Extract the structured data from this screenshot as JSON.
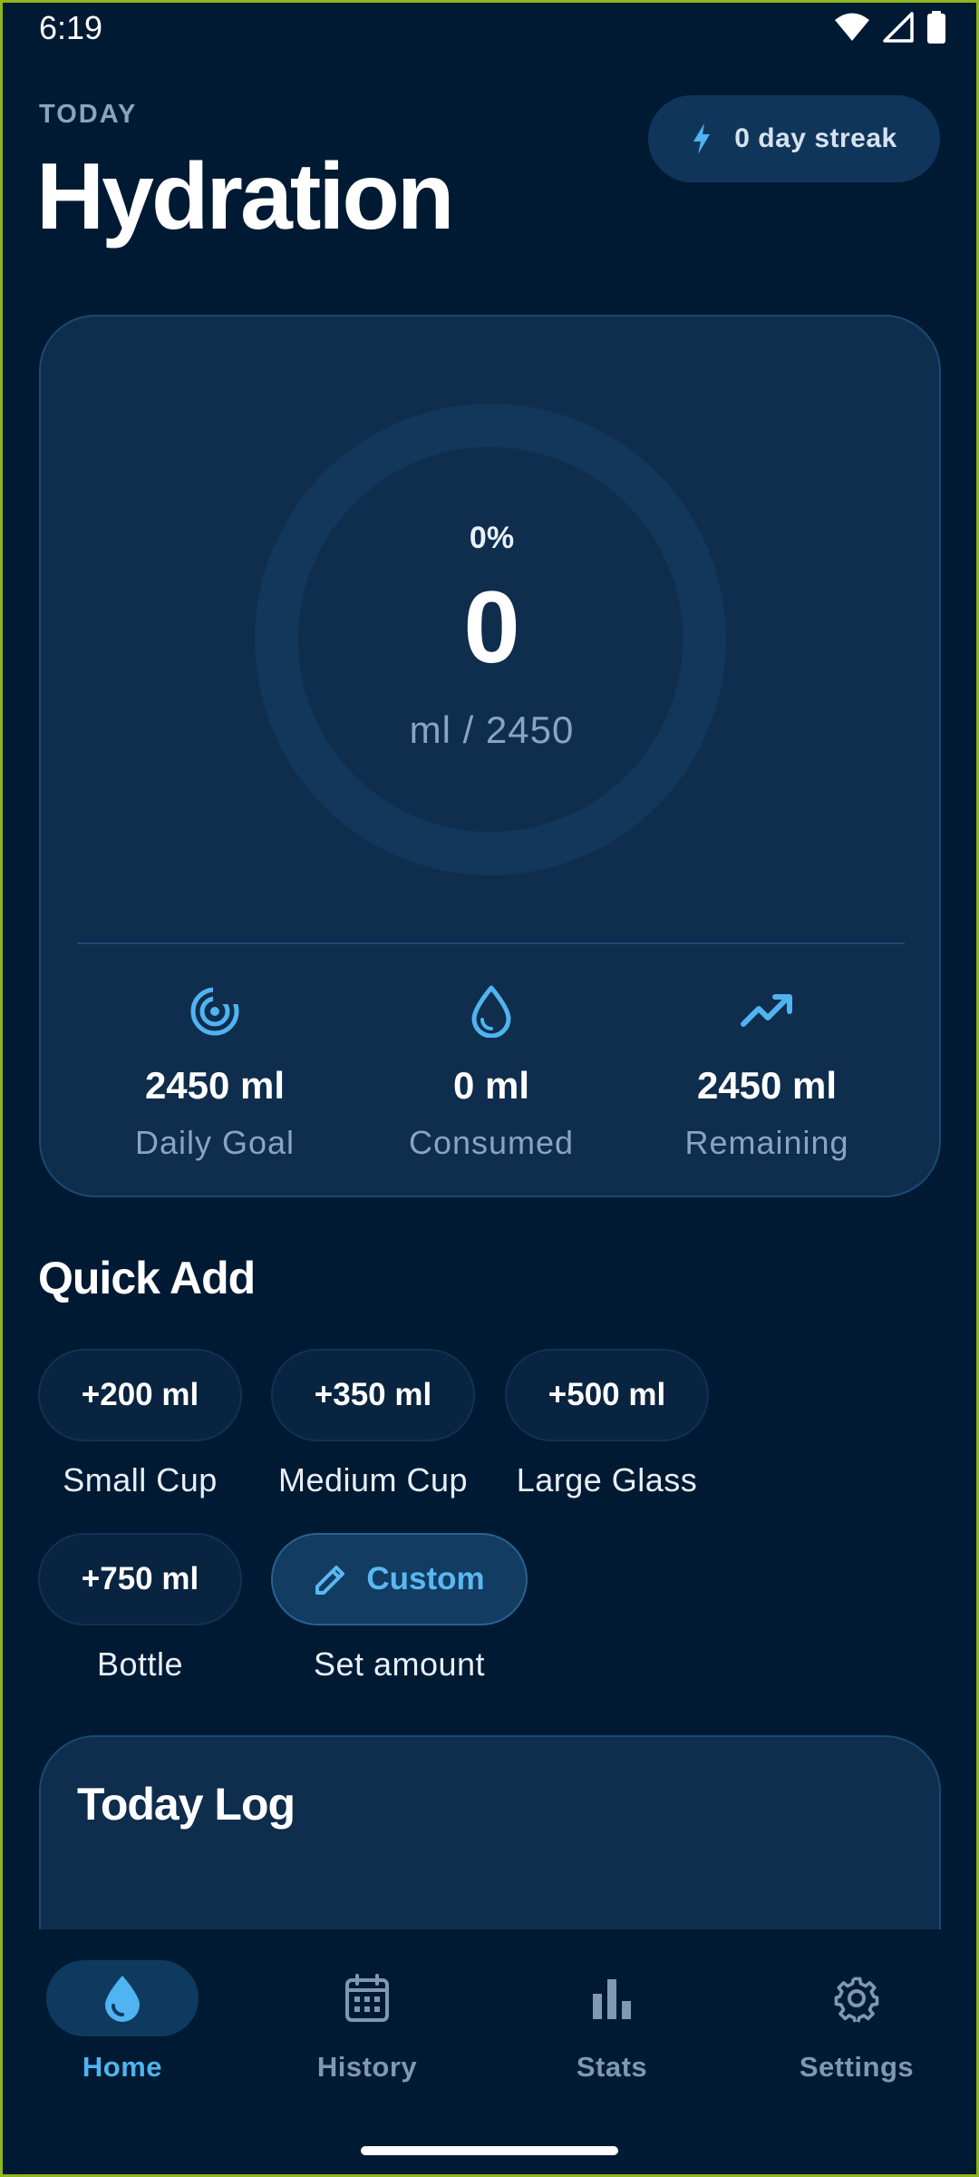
{
  "status_bar": {
    "time": "6:19"
  },
  "header": {
    "eyebrow": "TODAY",
    "title": "Hydration",
    "streak": "0 day streak"
  },
  "progress": {
    "percent_text": "0%",
    "percent": 0,
    "consumed_value": "0",
    "unit_text": "ml / 2450"
  },
  "stats": [
    {
      "value": "2450 ml",
      "label": "Daily Goal",
      "icon": "target-icon"
    },
    {
      "value": "0 ml",
      "label": "Consumed",
      "icon": "water-drop-icon"
    },
    {
      "value": "2450 ml",
      "label": "Remaining",
      "icon": "trending-up-icon"
    }
  ],
  "quick_add": {
    "title": "Quick Add",
    "items": [
      {
        "amount": "+200 ml",
        "caption": "Small Cup"
      },
      {
        "amount": "+350 ml",
        "caption": "Medium Cup"
      },
      {
        "amount": "+500 ml",
        "caption": "Large Glass"
      },
      {
        "amount": "+750 ml",
        "caption": "Bottle"
      }
    ],
    "custom": {
      "label": "Custom",
      "caption": "Set amount",
      "icon": "pencil-icon"
    }
  },
  "log": {
    "title": "Today Log"
  },
  "nav": [
    {
      "label": "Home",
      "icon": "water-drop-icon",
      "active": true
    },
    {
      "label": "History",
      "icon": "calendar-icon",
      "active": false
    },
    {
      "label": "Stats",
      "icon": "bar-chart-icon",
      "active": false
    },
    {
      "label": "Settings",
      "icon": "gear-icon",
      "active": false
    }
  ],
  "colors": {
    "background": "#011a33",
    "card": "#0f2d4d",
    "accent": "#4fb4f0",
    "muted_text": "#8aa4c0"
  }
}
